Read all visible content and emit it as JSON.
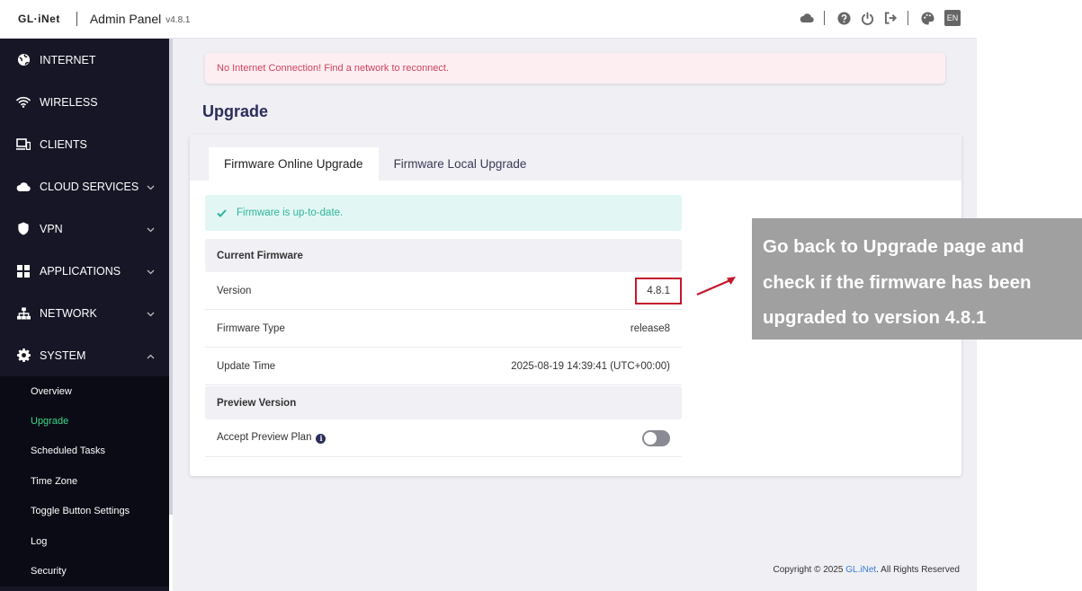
{
  "header": {
    "logo": "GL·iNet",
    "title": "Admin Panel",
    "version": "v4.8.1",
    "icons": [
      "cloud-icon",
      "help-icon",
      "power-icon",
      "logout-icon",
      "theme-icon"
    ],
    "lang": "EN"
  },
  "sidebar": {
    "items": [
      {
        "label": "INTERNET",
        "icon": "globe-icon"
      },
      {
        "label": "WIRELESS",
        "icon": "wifi-icon"
      },
      {
        "label": "CLIENTS",
        "icon": "devices-icon"
      },
      {
        "label": "CLOUD SERVICES",
        "icon": "cloud-icon",
        "expandable": true
      },
      {
        "label": "VPN",
        "icon": "shield-icon",
        "expandable": true
      },
      {
        "label": "APPLICATIONS",
        "icon": "apps-icon",
        "expandable": true
      },
      {
        "label": "NETWORK",
        "icon": "network-icon",
        "expandable": true
      },
      {
        "label": "SYSTEM",
        "icon": "gear-icon",
        "expandable": true,
        "expanded": true
      }
    ],
    "submenu": [
      "Overview",
      "Upgrade",
      "Scheduled Tasks",
      "Time Zone",
      "Toggle Button Settings",
      "Log",
      "Security"
    ],
    "active_sub": "Upgrade"
  },
  "main": {
    "alert": "No Internet Connection! Find a network to reconnect.",
    "page_title": "Upgrade",
    "tabs": [
      "Firmware Online Upgrade",
      "Firmware Local Upgrade"
    ],
    "active_tab": "Firmware Online Upgrade",
    "status": "Firmware is up-to-date.",
    "current_firmware": {
      "header": "Current Firmware",
      "rows": [
        {
          "label": "Version",
          "value": "4.8.1"
        },
        {
          "label": "Firmware Type",
          "value": "release8"
        },
        {
          "label": "Update Time",
          "value": "2025-08-19 14:39:41 (UTC+00:00)"
        }
      ]
    },
    "preview": {
      "header": "Preview Version",
      "label": "Accept Preview Plan",
      "enabled": false
    },
    "footer": {
      "prefix": "Copyright © 2025 ",
      "brand": "GL.iNet",
      "suffix": ". All Rights Reserved"
    }
  },
  "annotation": {
    "lines": [
      "Go back to Upgrade page and",
      "check if the firmware has been",
      "upgraded to version 4.8.1"
    ],
    "highlight_color": "#c4172c"
  },
  "colors": {
    "sidebar_bg": "#161626",
    "active_green": "#39d98a",
    "title_navy": "#2b2d5a",
    "alert_text": "#d2435e",
    "success_text": "#2fb59a"
  }
}
